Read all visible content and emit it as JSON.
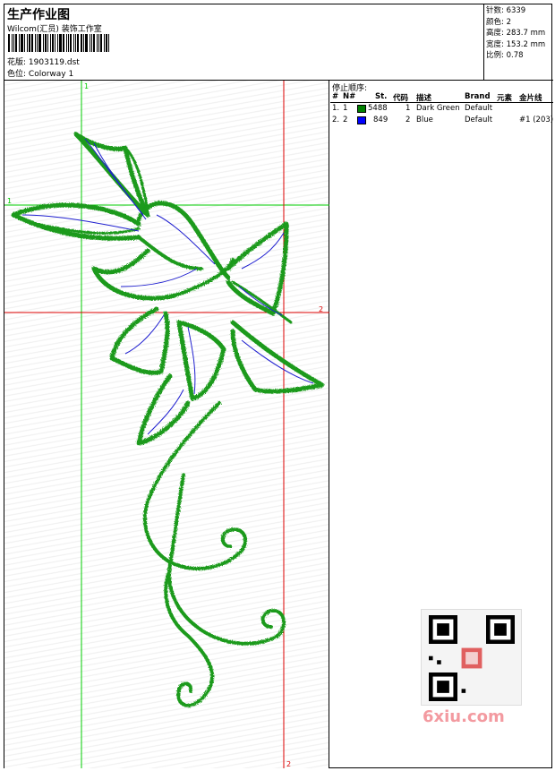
{
  "header": {
    "title": "生产作业图",
    "company": "Wilcom(汇员) 装饰工作室",
    "pattern_label": "花版:",
    "pattern_value": "1903119.dst",
    "colorway_label": "色位:",
    "colorway_value": "Colorway 1"
  },
  "stats": [
    {
      "label": "针数:",
      "value": "6339"
    },
    {
      "label": "颜色:",
      "value": "2"
    },
    {
      "label": "高度:",
      "value": "283.7 mm"
    },
    {
      "label": "宽度:",
      "value": "153.2 mm"
    },
    {
      "label": "比例:",
      "value": "0.78"
    }
  ],
  "stop_sequence": {
    "title": "停止顺序:",
    "columns": {
      "num": "#",
      "n": "N#",
      "st": "St.",
      "code": "代码",
      "desc": "描述",
      "brand": "Brand",
      "element": "元素",
      "sequin": "金片线"
    },
    "rows": [
      {
        "num": "1.",
        "n": "1",
        "color": "#008000",
        "st": "5488",
        "code": "1",
        "desc": "Dark Green",
        "brand": "Default",
        "sequin": ""
      },
      {
        "num": "2.",
        "n": "2",
        "color": "#0000ff",
        "st": "849",
        "code": "2",
        "desc": "Blue",
        "brand": "Default",
        "sequin": "#1 (203)"
      }
    ]
  },
  "design": {
    "marker_green_1": "1",
    "marker_green_1b": "1",
    "marker_red_2": "2",
    "marker_red_2b": "2",
    "thread_green": "#1a9a1a",
    "thread_blue": "#1f1fd0",
    "guide_green": "#00cc00",
    "guide_red": "#dd0000"
  },
  "watermark": {
    "text": "6xiu.com"
  }
}
